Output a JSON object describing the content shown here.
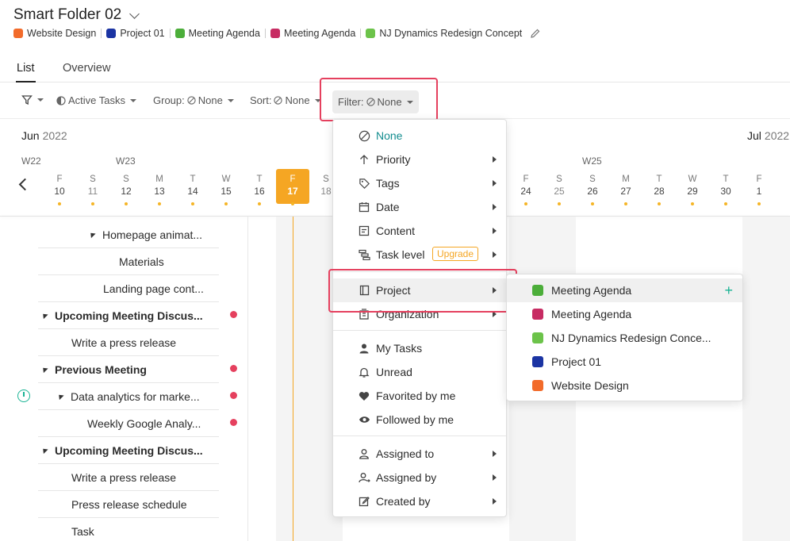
{
  "header": {
    "title": "Smart Folder 02",
    "projects": [
      {
        "name": "Website Design",
        "color": "#f26b2a"
      },
      {
        "name": "Project 01",
        "color": "#1b34a3"
      },
      {
        "name": "Meeting Agenda",
        "color": "#4cae3a"
      },
      {
        "name": "Meeting Agenda",
        "color": "#c72c63"
      },
      {
        "name": "NJ Dynamics Redesign Concept",
        "color": "#6cc34a"
      }
    ]
  },
  "tabs": [
    {
      "label": "List",
      "active": true
    },
    {
      "label": "Overview",
      "active": false
    }
  ],
  "toolbar": {
    "active_tasks": "Active Tasks",
    "group_label": "Group:",
    "group_value": "None",
    "sort_label": "Sort:",
    "sort_value": "None",
    "filter_label": "Filter:",
    "filter_value": "None"
  },
  "timeline": {
    "months": [
      {
        "name": "Jun",
        "year": "2022"
      },
      {
        "name": "Jul",
        "year": "2022"
      }
    ],
    "weeks": [
      "W22",
      "W23",
      "W25"
    ],
    "days": [
      {
        "dow": "F",
        "num": "10"
      },
      {
        "dow": "S",
        "num": "11"
      },
      {
        "dow": "S",
        "num": "12"
      },
      {
        "dow": "M",
        "num": "13"
      },
      {
        "dow": "T",
        "num": "14"
      },
      {
        "dow": "W",
        "num": "15"
      },
      {
        "dow": "T",
        "num": "16"
      },
      {
        "dow": "F",
        "num": "17"
      },
      {
        "dow": "S",
        "num": "18"
      },
      {
        "dow": "F",
        "num": "24"
      },
      {
        "dow": "S",
        "num": "25"
      },
      {
        "dow": "S",
        "num": "26"
      },
      {
        "dow": "M",
        "num": "27"
      },
      {
        "dow": "T",
        "num": "28"
      },
      {
        "dow": "W",
        "num": "29"
      },
      {
        "dow": "T",
        "num": "30"
      },
      {
        "dow": "F",
        "num": "1"
      }
    ],
    "today": "17"
  },
  "tasks": [
    {
      "label": "Homepage animat...",
      "bold": false,
      "expander": true,
      "dot": false
    },
    {
      "label": "Materials",
      "bold": false,
      "expander": false,
      "dot": false
    },
    {
      "label": "Landing page cont...",
      "bold": false,
      "expander": false,
      "dot": false
    },
    {
      "label": "Upcoming Meeting Discus...",
      "bold": true,
      "expander": true,
      "dot": true
    },
    {
      "label": "Write a press release",
      "bold": false,
      "expander": false,
      "dot": false
    },
    {
      "label": "Previous Meeting",
      "bold": true,
      "expander": true,
      "dot": true
    },
    {
      "label": "Data analytics for marke...",
      "bold": false,
      "expander": true,
      "dot": true
    },
    {
      "label": "Weekly Google Analy...",
      "bold": false,
      "expander": false,
      "dot": true
    },
    {
      "label": "Upcoming Meeting Discus...",
      "bold": true,
      "expander": true,
      "dot": false
    },
    {
      "label": "Write a press release",
      "bold": false,
      "expander": false,
      "dot": false
    },
    {
      "label": "Press release schedule",
      "bold": false,
      "expander": false,
      "dot": false
    },
    {
      "label": "Task",
      "bold": false,
      "expander": false,
      "dot": false
    }
  ],
  "filter_menu": {
    "items": [
      {
        "label": "None",
        "icon": "none-icon",
        "submenu": false
      },
      {
        "label": "Priority",
        "icon": "arrow-up-icon",
        "submenu": true
      },
      {
        "label": "Tags",
        "icon": "tag-icon",
        "submenu": true
      },
      {
        "label": "Date",
        "icon": "calendar-icon",
        "submenu": true
      },
      {
        "label": "Content",
        "icon": "content-icon",
        "submenu": true
      },
      {
        "label": "Task level",
        "icon": "task-level-icon",
        "submenu": true,
        "badge": "Upgrade"
      },
      {
        "label": "Project",
        "icon": "project-icon",
        "submenu": true
      },
      {
        "label": "Organization",
        "icon": "organization-icon",
        "submenu": true
      },
      {
        "label": "My Tasks",
        "icon": "user-icon",
        "submenu": false
      },
      {
        "label": "Unread",
        "icon": "bell-icon",
        "submenu": false
      },
      {
        "label": "Favorited by me",
        "icon": "heart-icon",
        "submenu": false
      },
      {
        "label": "Followed by me",
        "icon": "eye-icon",
        "submenu": false
      },
      {
        "label": "Assigned to",
        "icon": "user-outline-icon",
        "submenu": true
      },
      {
        "label": "Assigned by",
        "icon": "user-assign-icon",
        "submenu": true
      },
      {
        "label": "Created by",
        "icon": "edit-icon",
        "submenu": true
      }
    ]
  },
  "project_submenu": {
    "items": [
      {
        "label": "Meeting Agenda",
        "color": "#4cae3a"
      },
      {
        "label": "Meeting Agenda",
        "color": "#c72c63"
      },
      {
        "label": "NJ Dynamics Redesign Conce...",
        "color": "#6cc34a"
      },
      {
        "label": "Project 01",
        "color": "#1b34a3"
      },
      {
        "label": "Website Design",
        "color": "#f26b2a"
      }
    ],
    "add": "+"
  }
}
